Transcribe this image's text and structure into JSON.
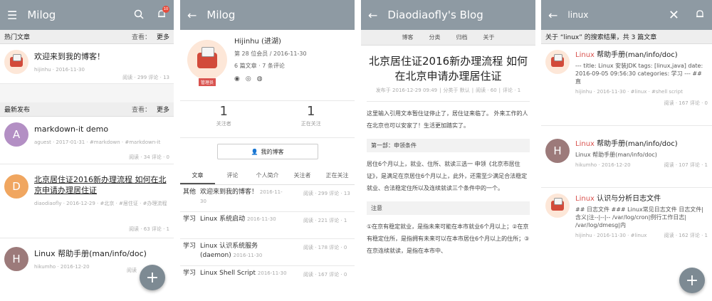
{
  "panel1": {
    "app_title": "Milog",
    "notif_count": "10",
    "hot_header": "热门文章",
    "hot_sort": "查看：",
    "hot_more": "更多",
    "hot_posts": [
      {
        "title": "欢迎来到我的博客！",
        "meta": "hijinhu · 2016-11-30",
        "stats": "阅读 · 299  评论 · 13"
      }
    ],
    "latest_header": "最新发布",
    "latest_sort": "查看：",
    "latest_more": "更多",
    "latest_posts": [
      {
        "letter": "A",
        "color": "#b38fc4",
        "title": "markdown-it demo",
        "meta": "aguest · 2017-01-31 · #markdown · #markdown-it",
        "stats": "阅读 · 34  评论 · 0"
      },
      {
        "letter": "D",
        "color": "#f0a660",
        "title": "北京居住证2016新办理流程 如何在北京申请办理居住证",
        "meta": "diaodiaofly · 2016-12-29 · #北京 · #居住证 · #办理流程",
        "stats": "阅读 · 63  评论 · 1"
      },
      {
        "letter": "H",
        "color": "#9c7a7a",
        "title": "Linux 帮助手册(man/info/doc)",
        "meta": "hikumho · 2016-12-20",
        "stats": "阅读"
      }
    ]
  },
  "panel2": {
    "app_title": "Milog",
    "name": "Hijinhu (进湖)",
    "member": "第 28 位会员 / 2016-11-30",
    "counts": "6 篇文章 · 7 条评论",
    "badge": "管理员",
    "followers_num": "1",
    "followers_lbl": "关注者",
    "following_num": "1",
    "following_lbl": "正在关注",
    "blog_btn": "我的博客",
    "tabs": [
      "文章",
      "评论",
      "个人简介",
      "关注者",
      "正在关注"
    ],
    "articles": [
      {
        "cat": "其他",
        "title": "欢迎来到我的博客！",
        "date": "2016-11-30",
        "stats": "阅读 · 299  评论 · 13"
      },
      {
        "cat": "学习",
        "title": "Linux 系统启动",
        "date": "2016-11-30",
        "stats": "阅读 · 221  评论 · 1"
      },
      {
        "cat": "学习",
        "title": "Linux 认识系统服务(daemon)",
        "date": "2016-11-30",
        "stats": "阅读 · 178  评论 · 0"
      },
      {
        "cat": "学习",
        "title": "Linux Shell Script",
        "date": "2016-11-30",
        "stats": "阅读 · 167  评论 · 0"
      }
    ]
  },
  "panel3": {
    "app_title": "Diaodiaofly's Blog",
    "nav": [
      "博客",
      "分类",
      "归档",
      "关于"
    ],
    "article_title": "北京居住证2016新办理流程 如何在北京申请办理居住证",
    "meta_date": "发布于 2016-12-29 09:49",
    "meta_cat": "分类于 默认",
    "meta_reads": "阅读 · 60",
    "meta_comments": "评论 · 1",
    "para1": "这里输入引用文本暂住证停止了，居住证来临了。 外来工作的人在北京也可以安家了！生活更加踏实了。",
    "h1": "第一部：申领条件",
    "para2": "居住6个月以上，就业、住所、就读三选一 申领《北京市居住证》，是满足在京居住6个月以上，此外，还需至少满足合法稳定就业、合法稳定住所以及连续就读三个条件中的一个。",
    "h2": "注意",
    "para3": "①在京有稳定就业，是指未来可能在本市就业6个月以上；②在京有稳定住所，是指拥有未来可以在本市居住6个月以上的住所；③在京连续就读，是指在本市中、"
  },
  "panel4": {
    "query": "linux",
    "summary": "关于 “linux” 的搜索结果，共 3 篇文章",
    "results": [
      {
        "kind": "img",
        "kw": "Linux",
        "title_rest": " 帮助手册(man/info/doc)",
        "snip": "--- title: Linux 安装JDK tags: [linux,java] date: 2016-09-05 09:56:30 categories: 学习 --- ## 直",
        "meta": "hijinhu · 2016-11-30 · #linux · #shell script",
        "stats": "阅读 · 167  评论 · 0"
      },
      {
        "kind": "letter",
        "letter": "H",
        "color": "#9c7a7a",
        "kw": "Linux",
        "title_rest": " 帮助手册(man/info/doc)",
        "snip": "Linux 帮助手册(man/info/doc)",
        "meta": "hikumho · 2016-12-20",
        "stats": "阅读 · 107  评论 · 1"
      },
      {
        "kind": "img",
        "kw": "Linux",
        "title_rest": " 认识与分析日志文件",
        "snip": "## 日志文件 ### Linux常见日志文件 日志文件|含义|注--|--|-- /var/log/cron|例行工作日志| /var/log/dmesg|内",
        "meta": "hijinhu · 2016-11-30 · #linux",
        "stats": "阅读 · 162  评论 · 1"
      }
    ]
  },
  "colors": {
    "appbar": "#8e9aa3",
    "keyword": "#d9534f",
    "fab": "#7d8a93"
  }
}
